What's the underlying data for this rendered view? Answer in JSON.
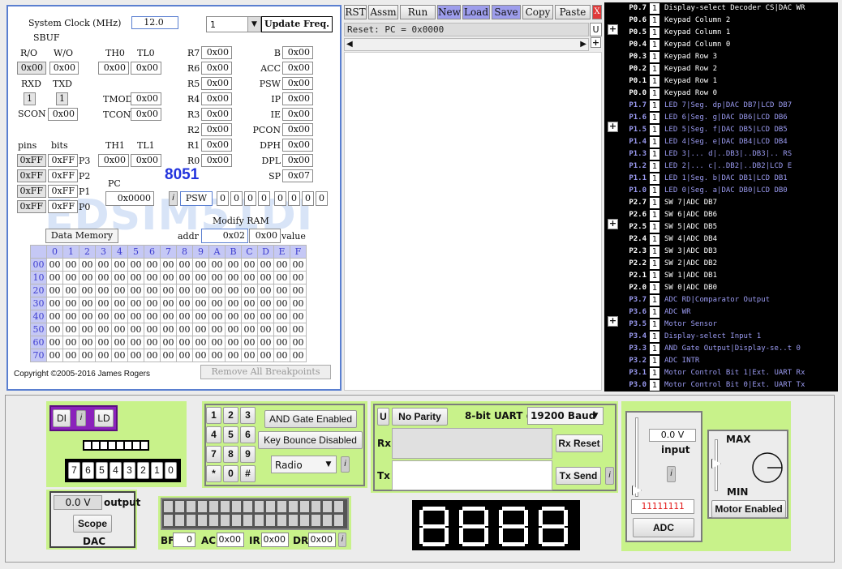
{
  "toolbar": {
    "rst": "RST",
    "assm": "Assm",
    "run": "Run",
    "new": "New",
    "load": "Load",
    "save": "Save",
    "copy": "Copy",
    "paste": "Paste",
    "close": "X",
    "reset_text": "Reset: PC = 0x0000",
    "u": "U"
  },
  "cpu": {
    "clock_label": "System Clock (MHz)",
    "clock_value": "12.0",
    "freq_select": "1",
    "update_freq": "Update Freq.",
    "sbuf": "SBUF",
    "ro": "R/O",
    "wo": "W/O",
    "sbuf_ro": "0x00",
    "sbuf_wo": "0x00",
    "rxd": "RXD",
    "txd": "TXD",
    "rxd_val": "1",
    "txd_val": "1",
    "scon": "SCON",
    "scon_val": "0x00",
    "th0": "TH0",
    "tl0": "TL0",
    "th0_val": "0x00",
    "tl0_val": "0x00",
    "tmod": "TMOD",
    "tmod_val": "0x00",
    "tcon": "TCON",
    "tcon_val": "0x00",
    "th1": "TH1",
    "tl1": "TL1",
    "th1_val": "0x00",
    "tl1_val": "0x00",
    "pins": "pins",
    "bits": "bits",
    "ports": [
      {
        "pin": "0xFF",
        "bits": "0xFF",
        "name": "P3"
      },
      {
        "pin": "0xFF",
        "bits": "0xFF",
        "name": "P2"
      },
      {
        "pin": "0xFF",
        "bits": "0xFF",
        "name": "P1"
      },
      {
        "pin": "0xFF",
        "bits": "0xFF",
        "name": "P0"
      }
    ],
    "regs": [
      {
        "n": "R7",
        "v": "0x00"
      },
      {
        "n": "R6",
        "v": "0x00"
      },
      {
        "n": "R5",
        "v": "0x00"
      },
      {
        "n": "R4",
        "v": "0x00"
      },
      {
        "n": "R3",
        "v": "0x00"
      },
      {
        "n": "R2",
        "v": "0x00"
      },
      {
        "n": "R1",
        "v": "0x00"
      },
      {
        "n": "R0",
        "v": "0x00"
      }
    ],
    "sfr": [
      {
        "n": "B",
        "v": "0x00"
      },
      {
        "n": "ACC",
        "v": "0x00"
      },
      {
        "n": "PSW",
        "v": "0x00"
      },
      {
        "n": "IP",
        "v": "0x00"
      },
      {
        "n": "IE",
        "v": "0x00"
      },
      {
        "n": "PCON",
        "v": "0x00"
      },
      {
        "n": "DPH",
        "v": "0x00"
      },
      {
        "n": "DPL",
        "v": "0x00"
      },
      {
        "n": "SP",
        "v": "0x07"
      }
    ],
    "chip": "8051",
    "pc": "PC",
    "pc_val": "0x0000",
    "info": "i",
    "psw": "PSW",
    "psw_bits": [
      "0",
      "0",
      "0",
      "0",
      "0",
      "0",
      "0",
      "0"
    ],
    "modify_ram": "Modify RAM",
    "data_memory": "Data Memory",
    "addr": "addr",
    "addr_val": "0x02",
    "value_val": "0x00",
    "value": "value",
    "mem_cols": [
      "0",
      "1",
      "2",
      "3",
      "4",
      "5",
      "6",
      "7",
      "8",
      "9",
      "A",
      "B",
      "C",
      "D",
      "E",
      "F"
    ],
    "mem_rows": [
      "00",
      "10",
      "20",
      "30",
      "40",
      "50",
      "60",
      "70"
    ],
    "mem_val": "00",
    "copyright": "Copyright ©2005-2016 James Rogers",
    "remove_bp": "Remove All Breakpoints",
    "watermark": "EDSIM51DI"
  },
  "port_pins": [
    {
      "p": "P0.7",
      "v": "1",
      "d": "Display-select Decoder CS|DAC WR",
      "c": "#ffffff"
    },
    {
      "p": "P0.6",
      "v": "1",
      "d": "Keypad Column 2",
      "c": "#ffffff"
    },
    {
      "p": "P0.5",
      "v": "1",
      "d": "Keypad Column 1",
      "c": "#ffffff"
    },
    {
      "p": "P0.4",
      "v": "1",
      "d": "Keypad Column 0",
      "c": "#ffffff"
    },
    {
      "p": "P0.3",
      "v": "1",
      "d": "Keypad Row 3",
      "c": "#ffffff"
    },
    {
      "p": "P0.2",
      "v": "1",
      "d": "Keypad Row 2",
      "c": "#ffffff"
    },
    {
      "p": "P0.1",
      "v": "1",
      "d": "Keypad Row 1",
      "c": "#ffffff"
    },
    {
      "p": "P0.0",
      "v": "1",
      "d": "Keypad Row 0",
      "c": "#ffffff"
    },
    {
      "p": "P1.7",
      "v": "1",
      "d": "LED 7|Seg. dp|DAC DB7|LCD DB7",
      "c": "#9a9af0"
    },
    {
      "p": "P1.6",
      "v": "1",
      "d": "LED 6|Seg. g|DAC DB6|LCD DB6",
      "c": "#9a9af0"
    },
    {
      "p": "P1.5",
      "v": "1",
      "d": "LED 5|Seg. f|DAC DB5|LCD DB5",
      "c": "#9a9af0"
    },
    {
      "p": "P1.4",
      "v": "1",
      "d": "LED 4|Seg. e|DAC DB4|LCD DB4",
      "c": "#9a9af0"
    },
    {
      "p": "P1.3",
      "v": "1",
      "d": "LED 3|... d|..DB3|..DB3|.. RS",
      "c": "#9a9af0"
    },
    {
      "p": "P1.2",
      "v": "1",
      "d": "LED 2|... c|..DB2|..DB2|LCD E",
      "c": "#9a9af0"
    },
    {
      "p": "P1.1",
      "v": "1",
      "d": "LED 1|Seg. b|DAC DB1|LCD DB1",
      "c": "#9a9af0"
    },
    {
      "p": "P1.0",
      "v": "1",
      "d": "LED 0|Seg. a|DAC DB0|LCD DB0",
      "c": "#9a9af0"
    },
    {
      "p": "P2.7",
      "v": "1",
      "d": "SW 7|ADC DB7",
      "c": "#ffffff"
    },
    {
      "p": "P2.6",
      "v": "1",
      "d": "SW 6|ADC DB6",
      "c": "#ffffff"
    },
    {
      "p": "P2.5",
      "v": "1",
      "d": "SW 5|ADC DB5",
      "c": "#ffffff"
    },
    {
      "p": "P2.4",
      "v": "1",
      "d": "SW 4|ADC DB4",
      "c": "#ffffff"
    },
    {
      "p": "P2.3",
      "v": "1",
      "d": "SW 3|ADC DB3",
      "c": "#ffffff"
    },
    {
      "p": "P2.2",
      "v": "1",
      "d": "SW 2|ADC DB2",
      "c": "#ffffff"
    },
    {
      "p": "P2.1",
      "v": "1",
      "d": "SW 1|ADC DB1",
      "c": "#ffffff"
    },
    {
      "p": "P2.0",
      "v": "1",
      "d": "SW 0|ADC DB0",
      "c": "#ffffff"
    },
    {
      "p": "P3.7",
      "v": "1",
      "d": "ADC RD|Comparator Output",
      "c": "#9a9af0"
    },
    {
      "p": "P3.6",
      "v": "1",
      "d": "ADC WR",
      "c": "#9a9af0"
    },
    {
      "p": "P3.5",
      "v": "1",
      "d": "Motor Sensor",
      "c": "#9a9af0"
    },
    {
      "p": "P3.4",
      "v": "1",
      "d": "Display-select Input 1",
      "c": "#9a9af0"
    },
    {
      "p": "P3.3",
      "v": "1",
      "d": "AND Gate Output|Display-se..t 0",
      "c": "#9a9af0"
    },
    {
      "p": "P3.2",
      "v": "1",
      "d": "ADC INTR",
      "c": "#9a9af0"
    },
    {
      "p": "P3.1",
      "v": "1",
      "d": "Motor Control Bit 1|Ext. UART Rx",
      "c": "#9a9af0"
    },
    {
      "p": "P3.0",
      "v": "1",
      "d": "Motor Control Bit 0|Ext. UART Tx",
      "c": "#9a9af0"
    }
  ],
  "plus": "+",
  "peripherals": {
    "di": "DI",
    "i": "i",
    "ld": "LD",
    "switch_labels": [
      "7",
      "6",
      "5",
      "4",
      "3",
      "2",
      "1",
      "0"
    ],
    "dac_value": "0.0 V",
    "dac_output": "output",
    "scope": "Scope",
    "dac": "DAC",
    "keypad": [
      "1",
      "2",
      "3",
      "4",
      "5",
      "6",
      "7",
      "8",
      "9",
      "*",
      "0",
      "#"
    ],
    "and_gate": "AND Gate Enabled",
    "key_bounce": "Key Bounce Disabled",
    "radio": "Radio",
    "lcd": {
      "bf": "BF",
      "bf_val": "0",
      "ac": "AC",
      "ac_val": "0x00",
      "ir": "IR",
      "ir_val": "0x00",
      "dr": "DR",
      "dr_val": "0x00"
    },
    "uart": {
      "u": "U",
      "parity": "No Parity",
      "mode": "8-bit UART @",
      "baud": "19200 Baud",
      "rx": "Rx",
      "tx": "Tx",
      "rx_reset": "Rx Reset",
      "tx_send": "Tx Send"
    },
    "adc": {
      "value": "0.0 V",
      "input": "input",
      "bits": "11111111",
      "adc": "ADC"
    },
    "motor": {
      "max": "MAX",
      "min": "MIN",
      "enabled": "Motor Enabled"
    }
  },
  "colors": {
    "accent_blue": "#2233dd",
    "green_panel": "#c8f28a",
    "purple": "#8b22bb",
    "port_blue": "#9a9af0"
  }
}
